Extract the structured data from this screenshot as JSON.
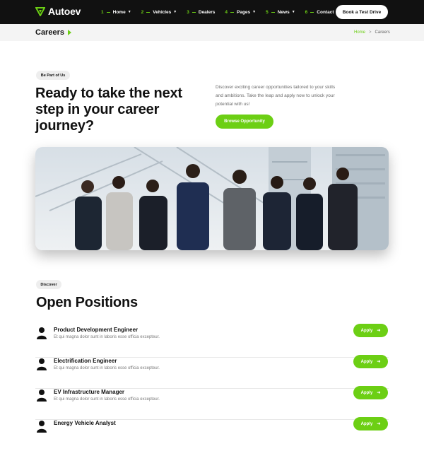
{
  "brand": {
    "name": "Autoev",
    "accent": "#6ccf14",
    "dark": "#111111"
  },
  "nav": {
    "items": [
      {
        "num": "1",
        "label": "Home",
        "has_caret": true
      },
      {
        "num": "2",
        "label": "Vehicles",
        "has_caret": true
      },
      {
        "num": "3",
        "label": "Dealers",
        "has_caret": false
      },
      {
        "num": "4",
        "label": "Pages",
        "has_caret": true
      },
      {
        "num": "5",
        "label": "News",
        "has_caret": true
      },
      {
        "num": "6",
        "label": "Contact",
        "has_caret": false
      }
    ],
    "cta_label": "Book a Test Drive"
  },
  "breadcrumb": {
    "title": "Careers",
    "home": "Home",
    "separator": ">",
    "current": "Careers"
  },
  "hero": {
    "badge": "Be Part of Us",
    "heading": "Ready to take the next step in your career journey?",
    "description": "Discover exciting career opportunities tailored to your skills and ambitions. Take the leap and apply now to unlock your potential with us!",
    "button_label": "Browse Opportunity"
  },
  "team_image": {
    "icon": "team-photo"
  },
  "positions": {
    "badge": "Discover",
    "title": "Open Positions",
    "apply_label": "Apply",
    "items": [
      {
        "title": "Product Development Engineer",
        "desc": "Et qui magna dolor sunt in laboris esse officia excepteur."
      },
      {
        "title": "Electrification Engineer",
        "desc": "Et qui magna dolor sunt in laboris esse officia excepteur."
      },
      {
        "title": "EV Infrastructure Manager",
        "desc": "Et qui magna dolor sunt in laboris esse officia excepteur."
      },
      {
        "title": "Energy Vehicle Analyst",
        "desc": ""
      }
    ]
  }
}
